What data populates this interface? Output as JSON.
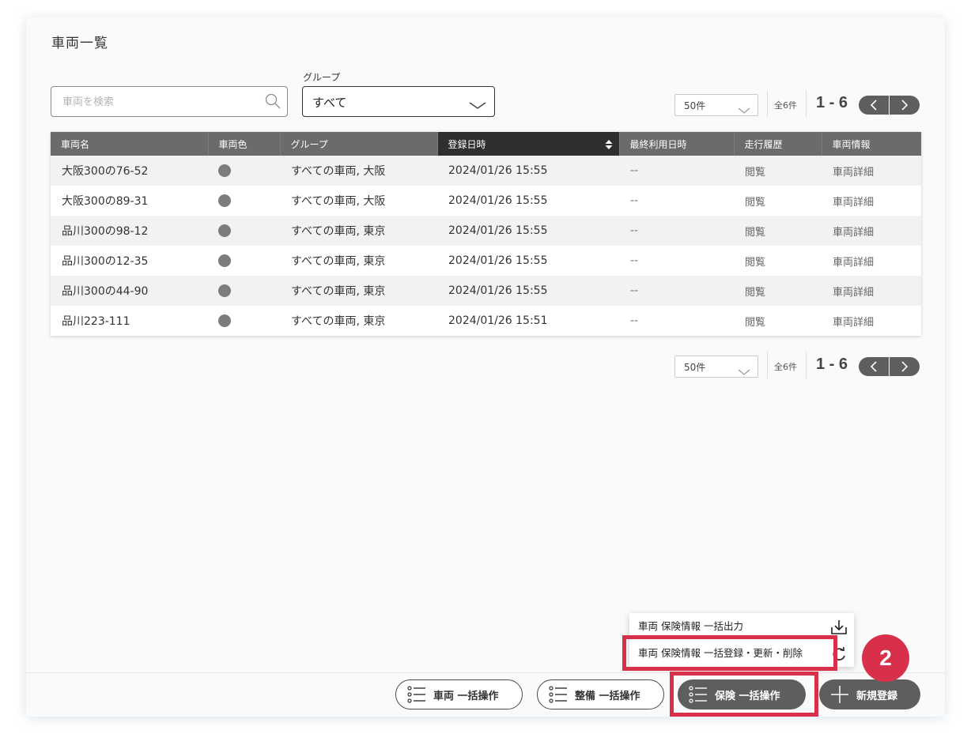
{
  "page": {
    "title": "車両一覧"
  },
  "search": {
    "placeholder": "車両を検索",
    "value": ""
  },
  "group_filter": {
    "label": "グループ",
    "selected": "すべて"
  },
  "pagination": {
    "per_page": "50件",
    "total": "全6件",
    "range": "1 - 6"
  },
  "table": {
    "headers": [
      "車両名",
      "車両色",
      "グループ",
      "登録日時",
      "最終利用日時",
      "走行履歴",
      "車両情報"
    ],
    "sorted_column": "登録日時",
    "rows": [
      {
        "name": "大阪300の76-52",
        "color": "#7c7c7c",
        "group": "すべての車両, 大阪",
        "registered": "2024/01/26 15:55",
        "last_used": "--",
        "history": "閲覧",
        "info": "車両詳細"
      },
      {
        "name": "大阪300の89-31",
        "color": "#7c7c7c",
        "group": "すべての車両, 大阪",
        "registered": "2024/01/26 15:55",
        "last_used": "--",
        "history": "閲覧",
        "info": "車両詳細"
      },
      {
        "name": "品川300の98-12",
        "color": "#7c7c7c",
        "group": "すべての車両, 東京",
        "registered": "2024/01/26 15:55",
        "last_used": "--",
        "history": "閲覧",
        "info": "車両詳細"
      },
      {
        "name": "品川300の12-35",
        "color": "#7c7c7c",
        "group": "すべての車両, 東京",
        "registered": "2024/01/26 15:55",
        "last_used": "--",
        "history": "閲覧",
        "info": "車両詳細"
      },
      {
        "name": "品川300の44-90",
        "color": "#7c7c7c",
        "group": "すべての車両, 東京",
        "registered": "2024/01/26 15:55",
        "last_used": "--",
        "history": "閲覧",
        "info": "車両詳細"
      },
      {
        "name": "品川223-111",
        "color": "#7c7c7c",
        "group": "すべての車両, 東京",
        "registered": "2024/01/26 15:51",
        "last_used": "--",
        "history": "閲覧",
        "info": "車両詳細"
      }
    ]
  },
  "bulk_menu": {
    "items": [
      {
        "label": "車両 保険情報 一括出力",
        "icon": "download-icon"
      },
      {
        "label": "車両 保険情報 一括登録・更新・削除",
        "icon": "refresh-icon"
      }
    ]
  },
  "bottom_bar": {
    "vehicle_bulk": "車両 一括操作",
    "maintenance_bulk": "整備 一括操作",
    "insurance_bulk": "保険 一括操作",
    "new_register": "新規登録"
  },
  "annotation": {
    "step": "2",
    "highlight_color": "#d8304a"
  }
}
